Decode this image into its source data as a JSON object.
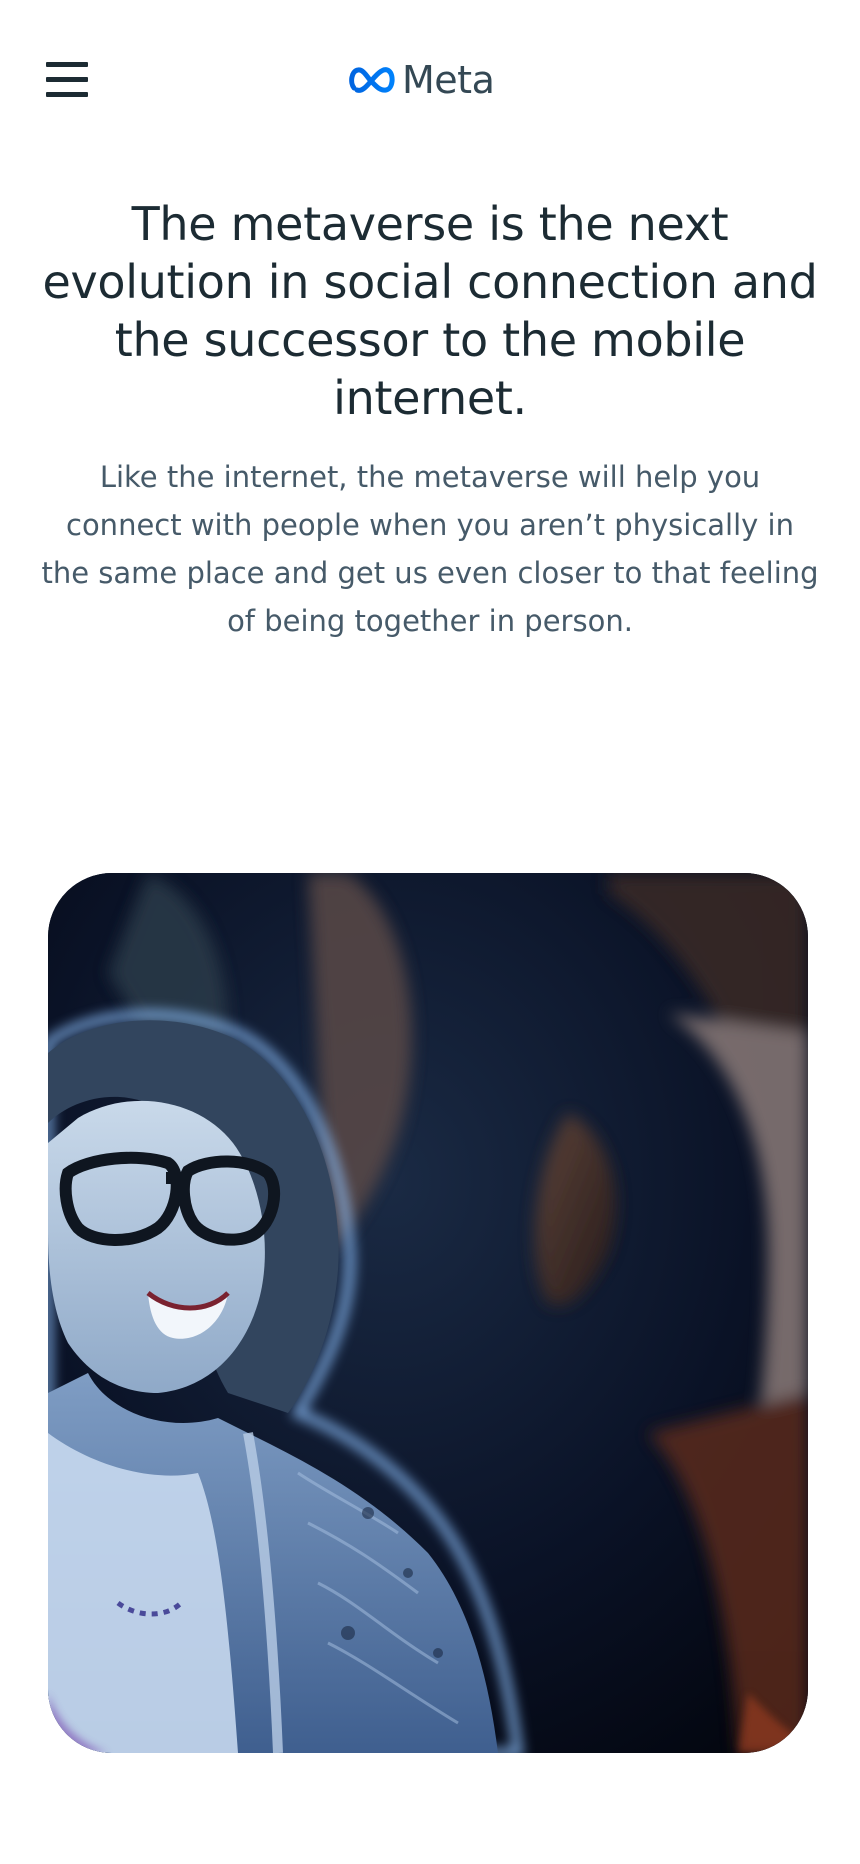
{
  "header": {
    "menu_icon": "hamburger-menu-icon",
    "logo": {
      "icon": "meta-infinity-logo-icon",
      "text": "Meta",
      "color_start": "#0064e0",
      "color_end": "#0081fb"
    }
  },
  "hero": {
    "title": "The metaverse is the next evolution in social connection and the successor to the mobile internet.",
    "description": "Like the internet, the metaverse will help you connect with people when you aren’t physically in the same place and get us even closer to that feeling of being together in person."
  },
  "media": {
    "kind": "video-still"
  },
  "colors": {
    "text_primary": "#1c2b33",
    "text_secondary": "#465a69",
    "background": "#ffffff"
  }
}
